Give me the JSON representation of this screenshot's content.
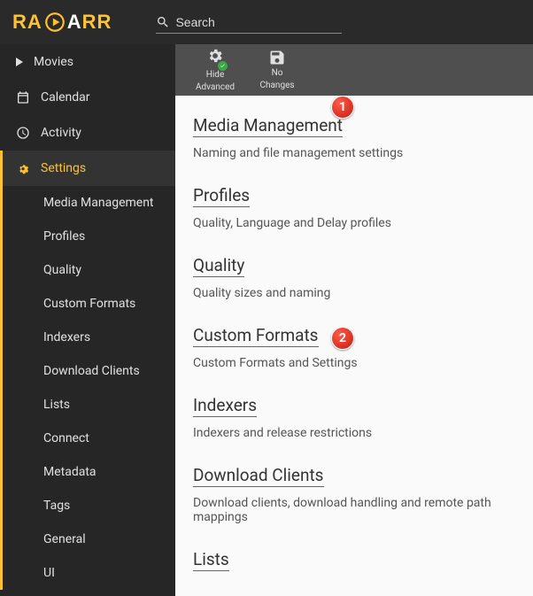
{
  "app_name": "RADARR",
  "search": {
    "placeholder": "Search"
  },
  "sidebar": {
    "primary": [
      {
        "label": "Movies"
      },
      {
        "label": "Calendar"
      },
      {
        "label": "Activity"
      },
      {
        "label": "Settings"
      }
    ],
    "settings_children": [
      "Media Management",
      "Profiles",
      "Quality",
      "Custom Formats",
      "Indexers",
      "Download Clients",
      "Lists",
      "Connect",
      "Metadata",
      "Tags",
      "General",
      "UI"
    ]
  },
  "toolbar": {
    "hide_advanced": {
      "line1": "Hide",
      "line2": "Advanced"
    },
    "no_changes": {
      "line1": "No",
      "line2": "Changes"
    }
  },
  "sections": [
    {
      "title": "Media Management",
      "desc": "Naming and file management settings"
    },
    {
      "title": "Profiles",
      "desc": "Quality, Language and Delay profiles"
    },
    {
      "title": "Quality",
      "desc": "Quality sizes and naming"
    },
    {
      "title": "Custom Formats",
      "desc": "Custom Formats and Settings"
    },
    {
      "title": "Indexers",
      "desc": "Indexers and release restrictions"
    },
    {
      "title": "Download Clients",
      "desc": "Download clients, download handling and remote path mappings"
    },
    {
      "title": "Lists",
      "desc": ""
    }
  ],
  "callouts": {
    "1": "1",
    "2": "2"
  },
  "colors": {
    "accent": "#ffc230",
    "sidebar_bg": "#262626",
    "topbar_bg": "#2a2a2a"
  }
}
